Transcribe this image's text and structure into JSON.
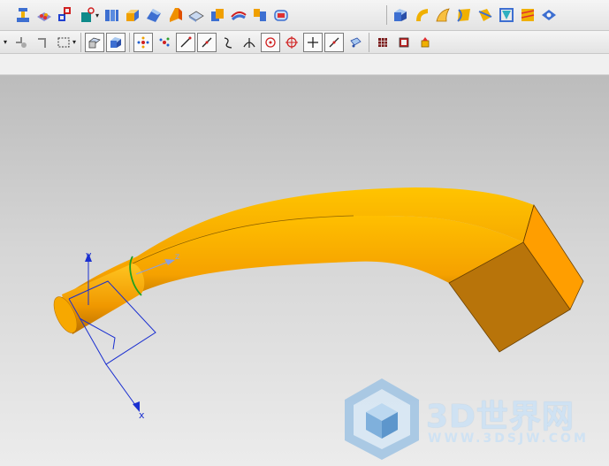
{
  "toolbar_top": {
    "icons": [
      "form-feature-icon",
      "pad-features-icon",
      "datum-csys-icon",
      "point-dropdown-icon",
      "extrude-icon",
      "block-icon",
      "chamfer-icon",
      "swept-icon",
      "face-blend-icon",
      "boolean-icon",
      "shell-icon",
      "trim-body-icon",
      "offset-face-icon",
      "box-icon",
      "sweep-surface-icon",
      "ruled-surface-icon",
      "through-curves-icon",
      "swept-along-icon",
      "n-sided-icon",
      "studio-surface-icon",
      "face-analysis-icon"
    ]
  },
  "toolbar_second": {
    "icons": [
      "snap-point-icon",
      "snap-endpoint-icon",
      "selection-box-icon",
      "wireframe-view-icon",
      "shaded-view-icon",
      "move-object-icon",
      "transform-icon",
      "line-icon",
      "arc-icon",
      "spline-icon",
      "perpendicular-icon",
      "circle-center-icon",
      "crosshair-icon",
      "line-through-icon",
      "point-set-icon",
      "grid-icon",
      "stop-render-icon",
      "highlight-icon"
    ]
  },
  "axes": {
    "y_label": "y",
    "z_label": "z",
    "x_label": "x"
  },
  "watermark": {
    "brand": "3D世界网",
    "url": "WWW.3DSJW.COM"
  },
  "colors": {
    "part": "#f7a800",
    "part_dark": "#b86e00",
    "axis": "#1a2fd0",
    "watermark": "#9fc3e3"
  }
}
